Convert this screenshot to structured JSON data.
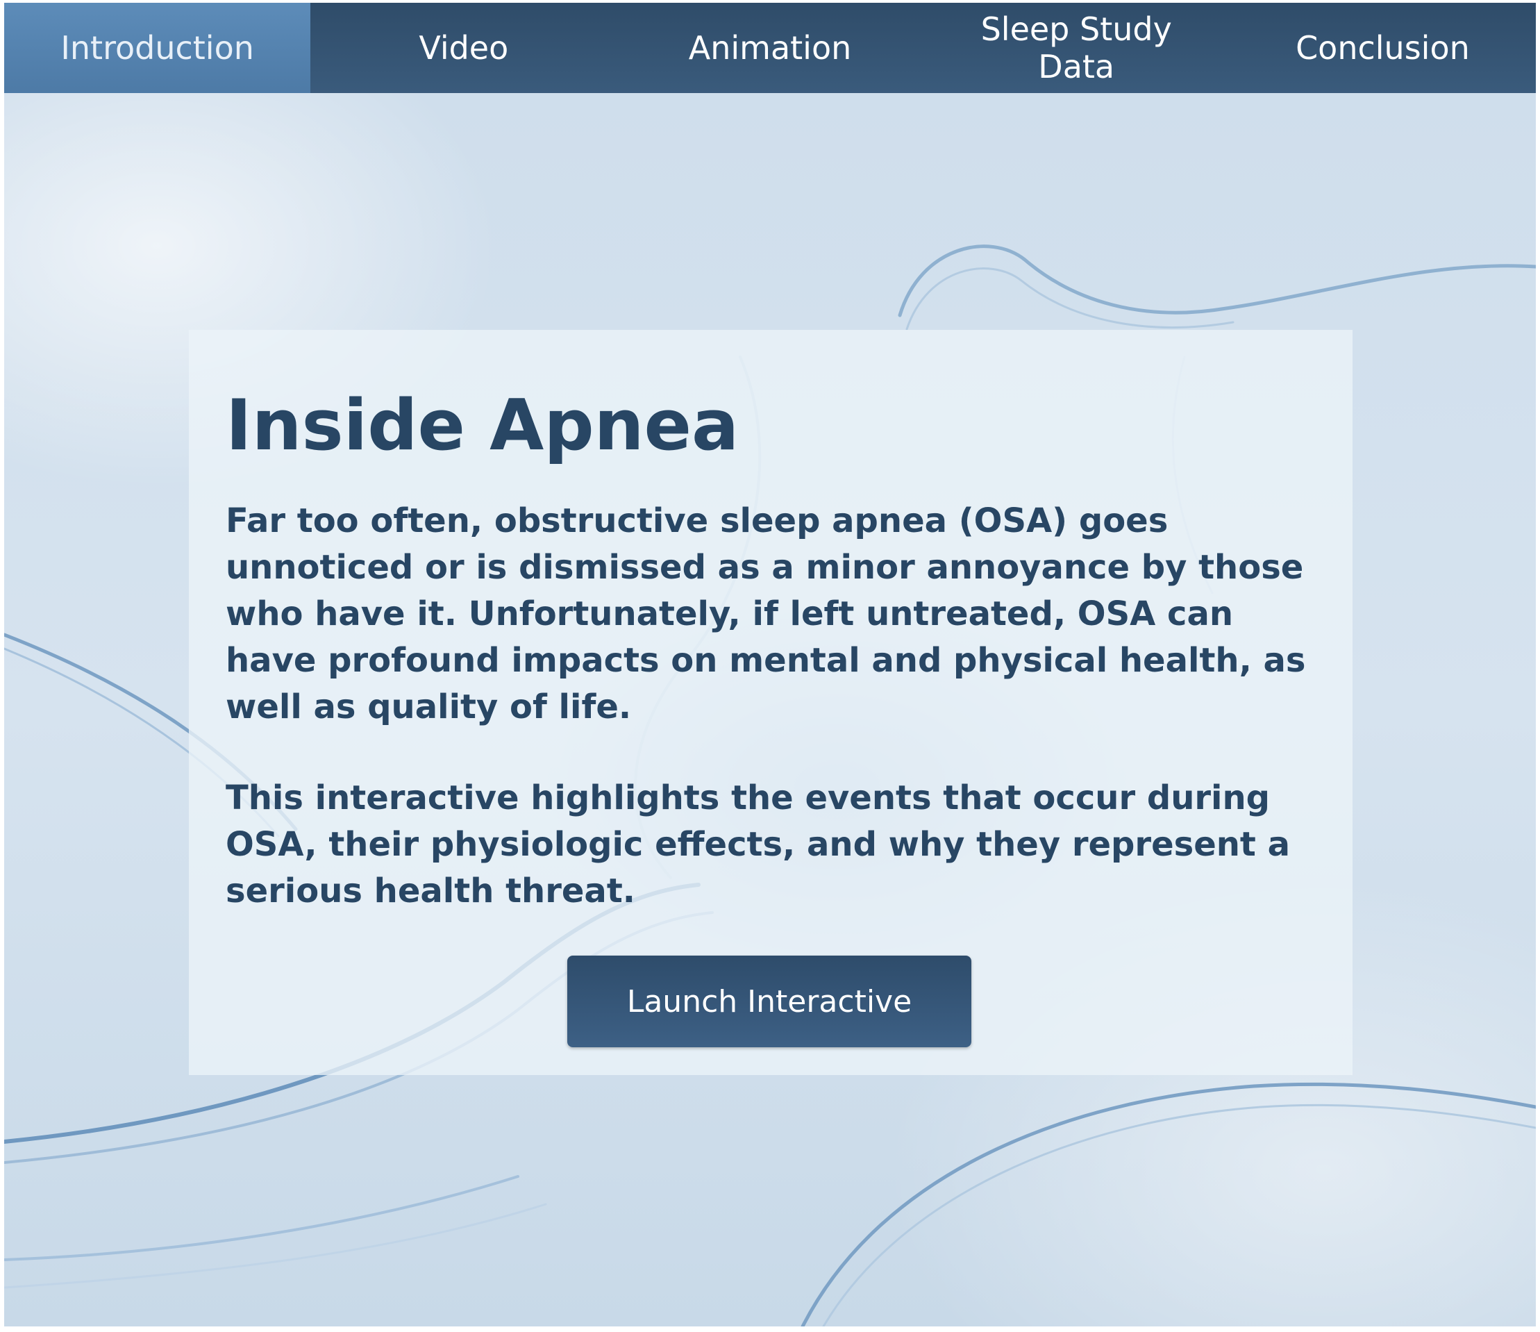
{
  "nav": {
    "tabs": [
      {
        "label": "Introduction",
        "active": true
      },
      {
        "label": "Video",
        "active": false
      },
      {
        "label": "Animation",
        "active": false
      },
      {
        "label": "Sleep Study Data",
        "active": false
      },
      {
        "label": "Conclusion",
        "active": false
      }
    ]
  },
  "main": {
    "title": "Inside Apnea",
    "paragraph1": "Far too often, obstructive sleep apnea (OSA) goes unnoticed or is dismissed as a minor annoyance by those who have it. Unfortunately, if left untreated, OSA can have profound impacts on mental and physical health, as well as quality of life.",
    "paragraph2": "This interactive highlights the events that occur during OSA, their physiologic effects, and why they represent a serious health threat.",
    "launch_label": "Launch Interactive"
  },
  "colors": {
    "nav_bar": "#2f4c69",
    "active_tab": "#5d8cb9",
    "text": "#284664",
    "button": "#2e4c6b"
  }
}
